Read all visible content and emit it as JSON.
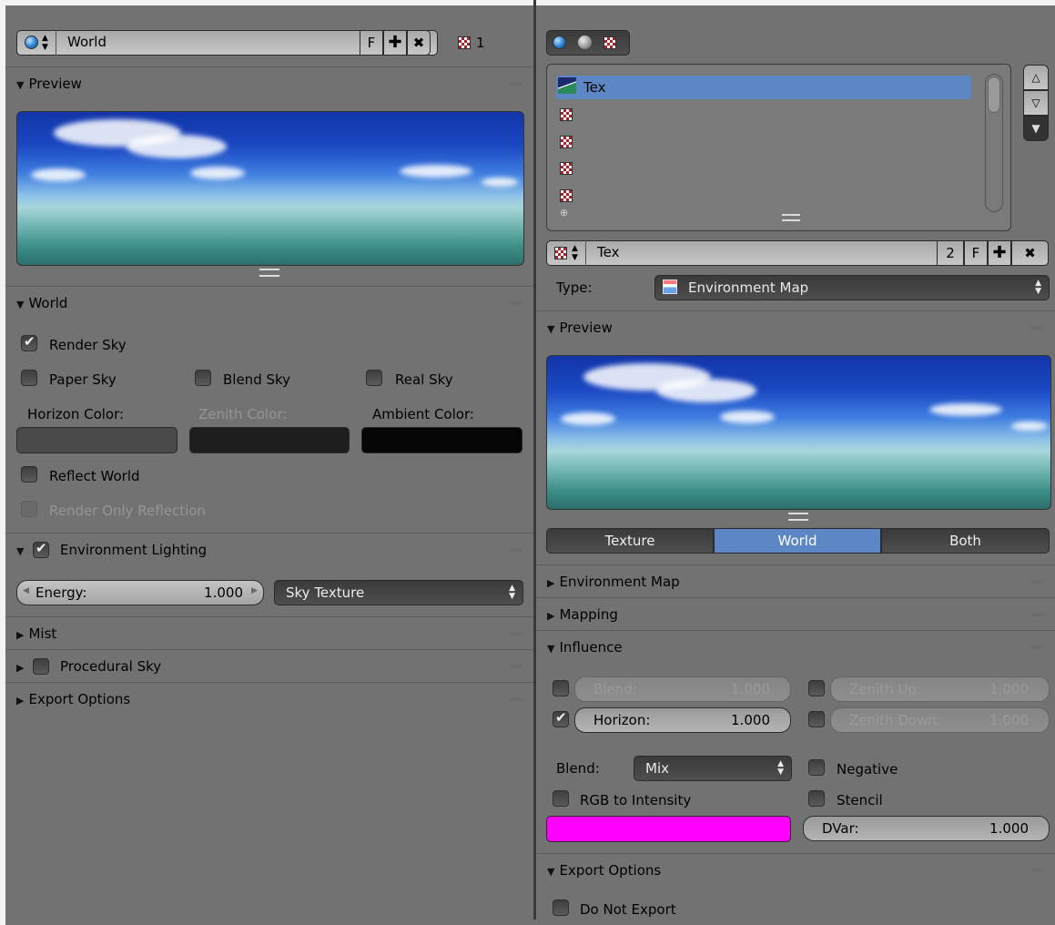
{
  "left": {
    "datablock": {
      "name": "World",
      "fake_user": "F",
      "users": "1"
    },
    "preview": {
      "title": "Preview"
    },
    "world": {
      "title": "World",
      "render_sky": "Render Sky",
      "paper_sky": "Paper Sky",
      "blend_sky": "Blend Sky",
      "real_sky": "Real Sky",
      "horizon_color": "Horizon Color:",
      "zenith_color": "Zenith Color:",
      "ambient_color": "Ambient Color:",
      "horizon_swatch": "#4a4a4a",
      "zenith_swatch": "#1e1e1e",
      "ambient_swatch": "#050505",
      "reflect_world": "Reflect World",
      "render_only_reflection": "Render Only Reflection"
    },
    "env_lighting": {
      "title": "Environment Lighting",
      "energy_label": "Energy:",
      "energy_value": "1.000",
      "source": "Sky Texture"
    },
    "mist": {
      "title": "Mist"
    },
    "procedural_sky": {
      "title": "Procedural Sky"
    },
    "export_options": {
      "title": "Export Options"
    }
  },
  "right": {
    "texture_slots": [
      {
        "name": "Tex",
        "selected": true
      },
      {
        "name": ""
      },
      {
        "name": ""
      },
      {
        "name": ""
      },
      {
        "name": ""
      }
    ],
    "datablock": {
      "name": "Tex",
      "users": "2",
      "fake_user": "F"
    },
    "type": {
      "label": "Type:",
      "value": "Environment Map"
    },
    "preview": {
      "title": "Preview",
      "tabs": [
        "Texture",
        "World",
        "Both"
      ],
      "active_tab": "World"
    },
    "environment_map": {
      "title": "Environment Map"
    },
    "mapping": {
      "title": "Mapping"
    },
    "influence": {
      "title": "Influence",
      "blend_label": "Blend:",
      "blend_value": "1.000",
      "horizon_label": "Horizon:",
      "horizon_value": "1.000",
      "zenith_up_label": "Zenith Up:",
      "zenith_up_value": "1.000",
      "zenith_down_label": "Zenith Down:",
      "zenith_down_value": "1.000",
      "blend_mode_label": "Blend:",
      "blend_mode_value": "Mix",
      "negative": "Negative",
      "rgb_to_intensity": "RGB to Intensity",
      "stencil": "Stencil",
      "color_swatch": "#ff00ff",
      "dvar_label": "DVar:",
      "dvar_value": "1.000"
    },
    "export_options": {
      "title": "Export Options",
      "do_not_export": "Do Not Export"
    }
  }
}
